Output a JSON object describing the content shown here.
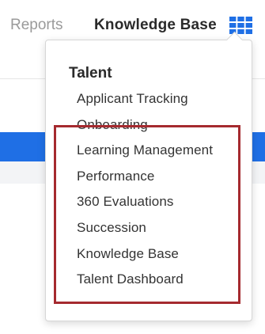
{
  "topnav": {
    "reports_label": "Reports",
    "knowledge_base_label": "Knowledge Base",
    "apps_icon": "grid-icon",
    "apps_icon_color": "#1f6fe5"
  },
  "dropdown": {
    "section_title": "Talent",
    "items": [
      {
        "label": "Applicant Tracking"
      },
      {
        "label": "Onboarding"
      },
      {
        "label": "Learning Management"
      },
      {
        "label": "Performance"
      },
      {
        "label": "360 Evaluations"
      },
      {
        "label": "Succession"
      },
      {
        "label": "Knowledge Base"
      },
      {
        "label": "Talent Dashboard"
      }
    ]
  },
  "colors": {
    "accent": "#1f6fe5",
    "highlight_border": "#a52a2f"
  }
}
